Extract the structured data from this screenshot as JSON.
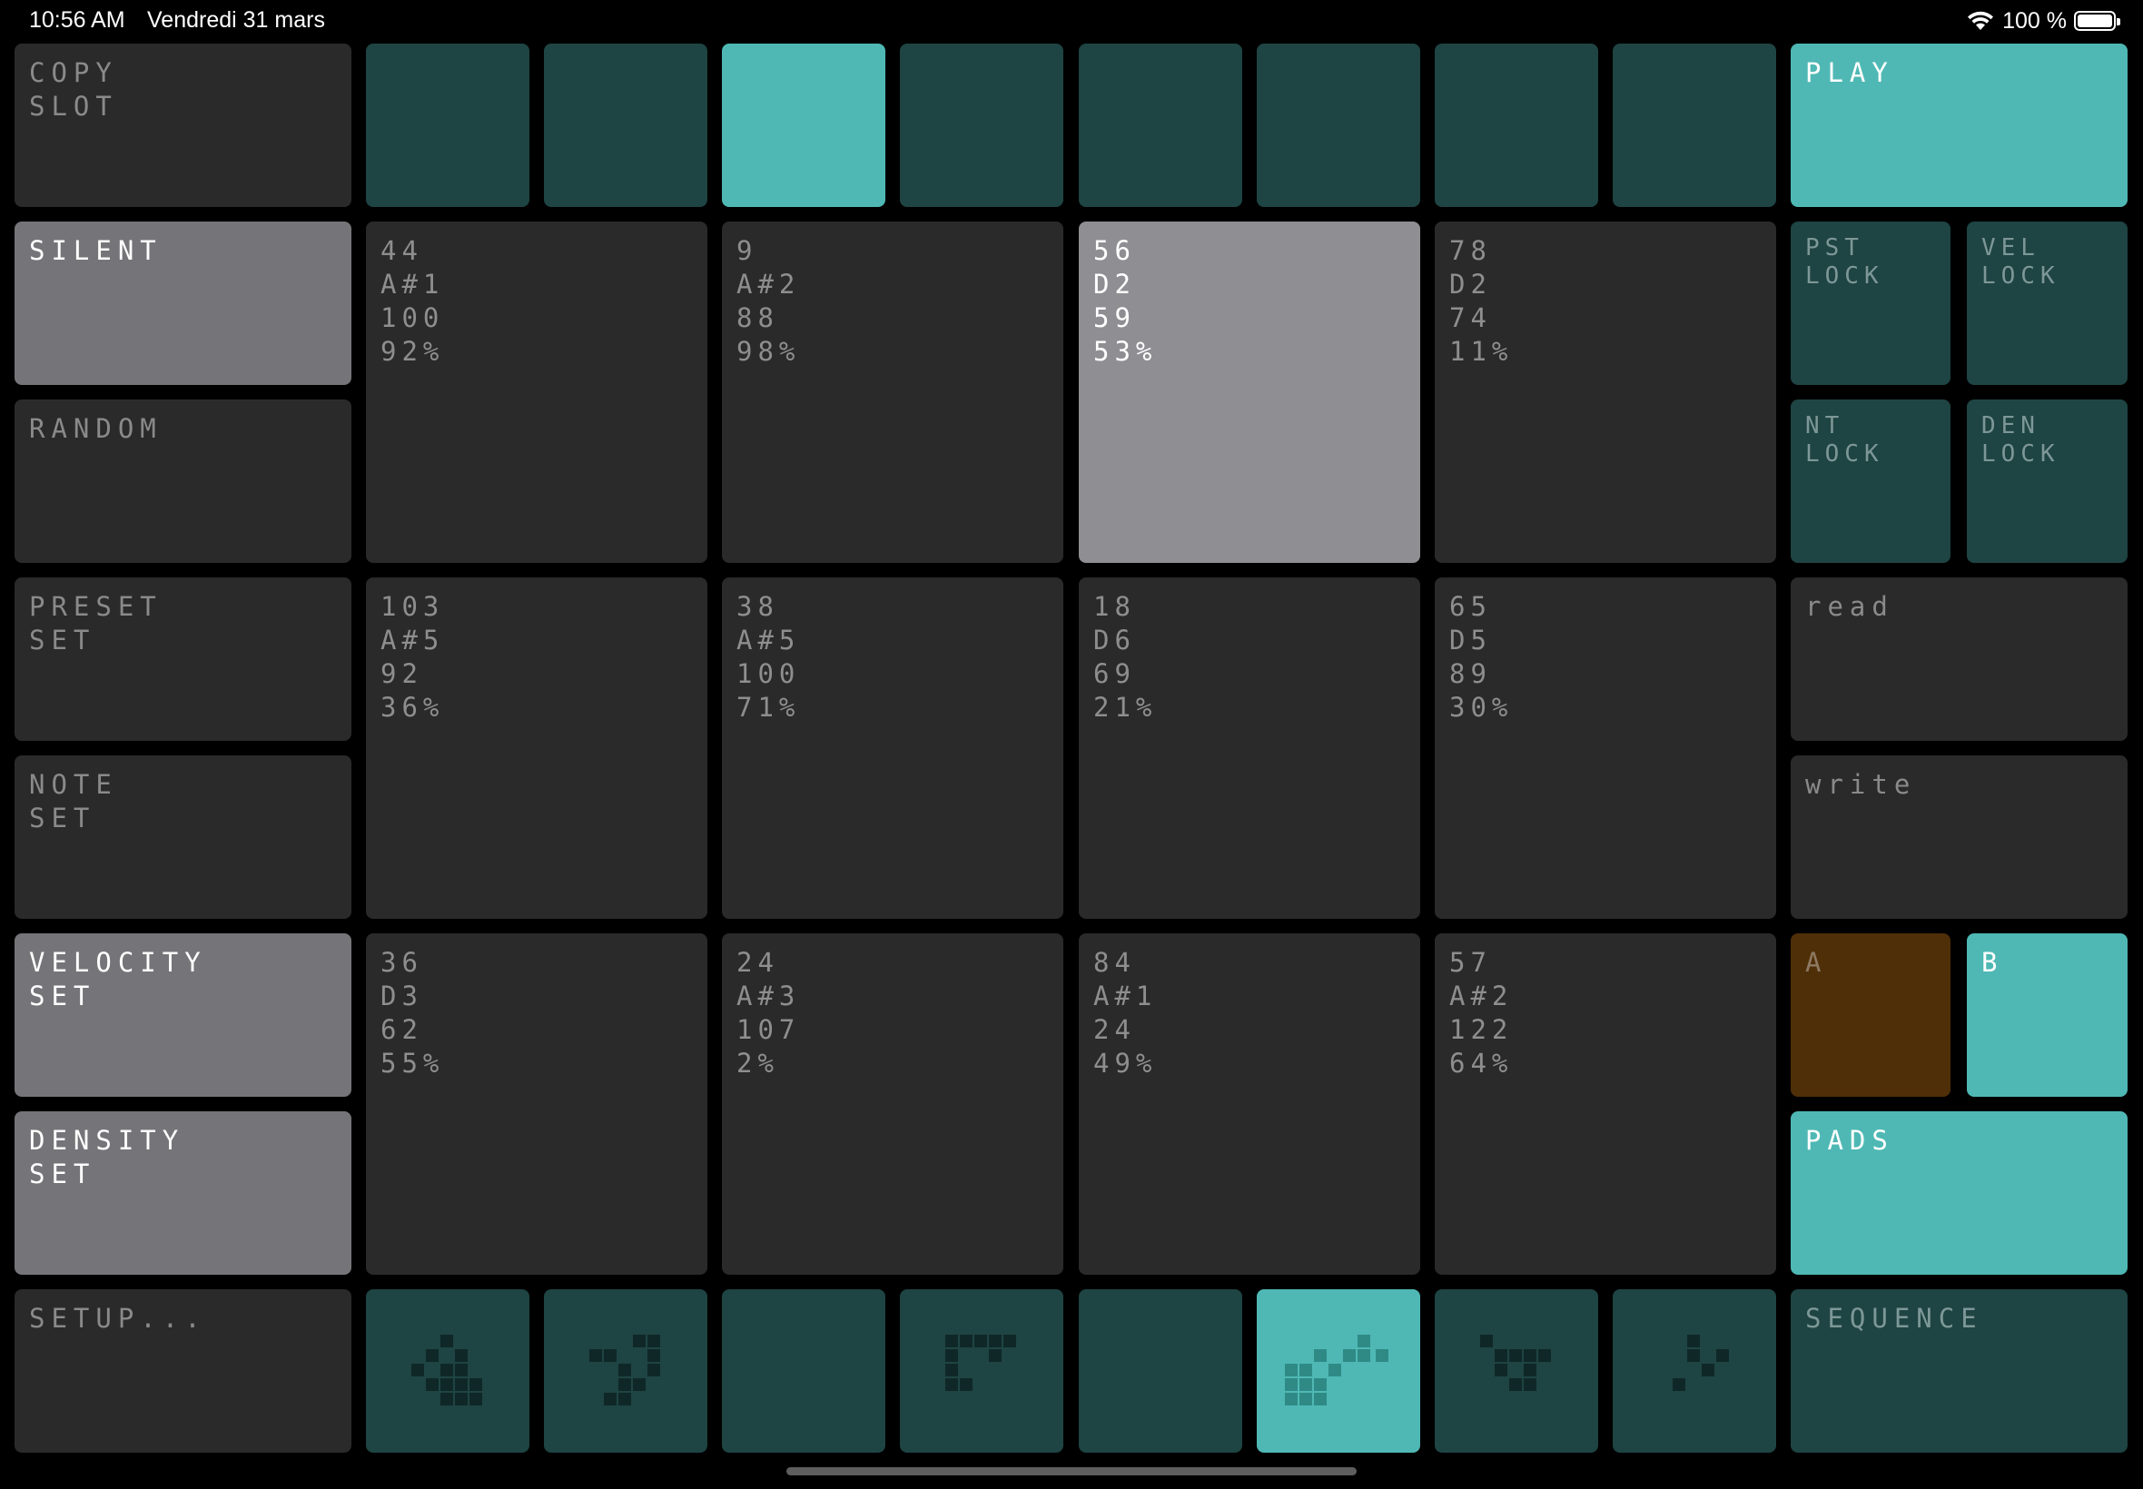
{
  "status_bar": {
    "time": "10:56 AM",
    "date": "Vendredi 31 mars",
    "battery": "100 %"
  },
  "left_buttons": {
    "copy_slot": "COPY\nSLOT",
    "silent": "SILENT",
    "random": "RANDOM",
    "preset_set": "PRESET\nSET",
    "note_set": "NOTE\nSET",
    "velocity_set": "VELOCITY\nSET",
    "density_set": "DENSITY\nSET",
    "setup": "SETUP..."
  },
  "right_buttons": {
    "play": "PLAY",
    "pst_lock": "PST\nLOCK",
    "vel_lock": "VEL\nLOCK",
    "nt_lock": "NT\nLOCK",
    "den_lock": "DEN\nLOCK",
    "read": "read",
    "write": "write",
    "a": "A",
    "b": "B",
    "pads": "PADS",
    "sequence": "SEQUENCE"
  },
  "top_slots": {
    "count": 8,
    "active_index": 2
  },
  "bottom_slots": {
    "count": 8,
    "active_index": 5
  },
  "pads": [
    {
      "preset": "44",
      "note": "A#1",
      "velocity": "100",
      "density": "92%"
    },
    {
      "preset": "9",
      "note": "A#2",
      "velocity": "88",
      "density": "98%"
    },
    {
      "preset": "56",
      "note": "D2",
      "velocity": "59",
      "density": "53%"
    },
    {
      "preset": "78",
      "note": "D2",
      "velocity": "74",
      "density": "11%"
    },
    {
      "preset": "103",
      "note": "A#5",
      "velocity": "92",
      "density": "36%"
    },
    {
      "preset": "38",
      "note": "A#5",
      "velocity": "100",
      "density": "71%"
    },
    {
      "preset": "18",
      "note": "D6",
      "velocity": "69",
      "density": "21%"
    },
    {
      "preset": "65",
      "note": "D5",
      "velocity": "89",
      "density": "30%"
    },
    {
      "preset": "36",
      "note": "D3",
      "velocity": "62",
      "density": "55%"
    },
    {
      "preset": "24",
      "note": "A#3",
      "velocity": "107",
      "density": "2%"
    },
    {
      "preset": "84",
      "note": "A#1",
      "velocity": "24",
      "density": "49%"
    },
    {
      "preset": "57",
      "note": "A#2",
      "velocity": "122",
      "density": "64%"
    }
  ],
  "active_pad_index": 2,
  "colors": {
    "teal_bright": "#4fb8b4",
    "teal_dark": "#1e4443",
    "cell_dark": "#2a2a2a",
    "gray": "#757579",
    "gray_light": "#8f8e93",
    "brown": "#4f2f08"
  },
  "icons": {
    "wifi": "wifi-icon",
    "battery": "battery-icon"
  }
}
